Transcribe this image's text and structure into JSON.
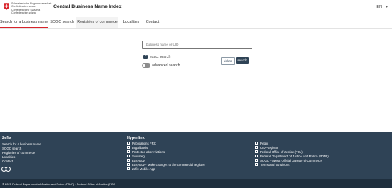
{
  "header": {
    "gov_lines": [
      "Schweizerische Eidgenossenschaft",
      "Confédération suisse",
      "Confederazione Svizzera",
      "Confederaziun svizra"
    ],
    "title": "Central Business Name Index",
    "language": "EN",
    "language_icon": "chevron-down-icon"
  },
  "nav": {
    "tabs": [
      {
        "label": "Search for a business name"
      },
      {
        "label": "SOGC search"
      },
      {
        "label": "Registries of commerce"
      },
      {
        "label": "Localities"
      },
      {
        "label": "Contact"
      }
    ]
  },
  "search": {
    "placeholder": "business name or UID",
    "exact_label": "exact search",
    "exact_checked": true,
    "advanced_label": "advanced search",
    "advanced_on": false,
    "delete_label": "delete",
    "search_label": "search"
  },
  "footer": {
    "zefix_heading": "Zefix",
    "zefix_links": [
      "Search for a business name",
      "SOGC search",
      "Registries of commerce",
      "Localities",
      "Contact"
    ],
    "hyperlink_heading": "Hyperlink",
    "hyperlinks_col1": [
      "Publications FRC",
      "Legal basis",
      "Protected abbreviations",
      "Swissreg",
      "EasyGov",
      "EasyGov - Make changes to the commercial register",
      "Zefix Mobile App"
    ],
    "hyperlinks_col2": [
      "Regix",
      "UID-Register",
      "Federal Office of Justice (FOJ)",
      "Federal Department of Justice and Police (FDJP)",
      "SOGC - Swiss Official Gazette of Commerce",
      "Terms and conditions"
    ],
    "copyright": "© 2025 Federal Department of Justice and Police (FDJP) - Federal Office of Justice (FOJ)"
  }
}
